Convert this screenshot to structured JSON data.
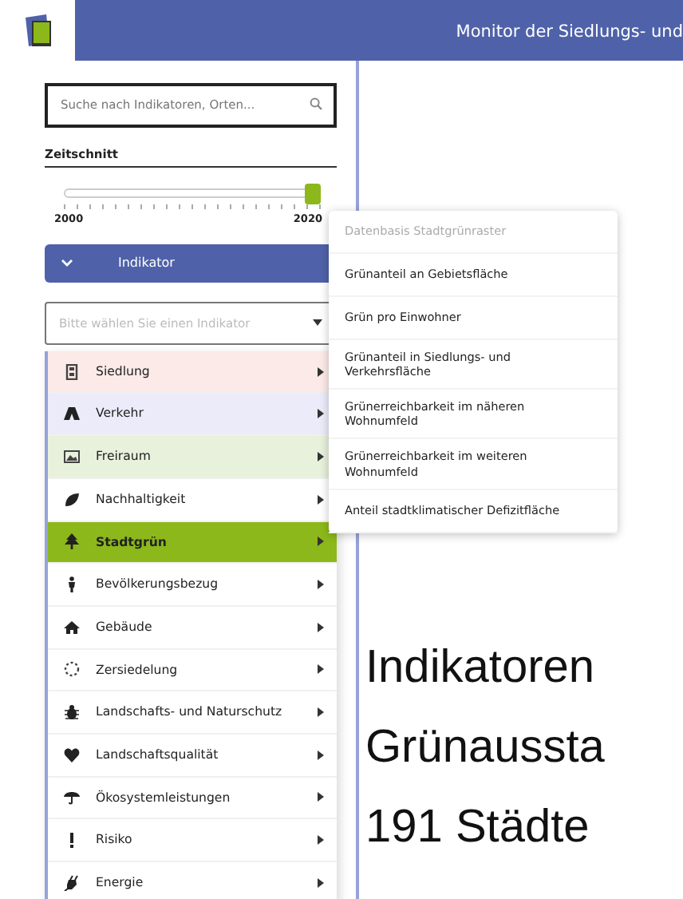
{
  "header": {
    "title": "Monitor der Siedlungs- und"
  },
  "search": {
    "placeholder": "Suche nach Indikatoren, Orten..."
  },
  "timeline": {
    "label": "Zeitschnitt",
    "level": 1.0,
    "start": "2000",
    "end": "2020"
  },
  "indicator_panel": {
    "title": "Indikator",
    "expanded": true
  },
  "indicator_select": {
    "placeholder": "Bitte wählen Sie einen Indikator"
  },
  "categories": [
    {
      "label": "Siedlung",
      "color": "#fbeae8",
      "selected": false
    },
    {
      "label": "Verkehr",
      "color": "#ebebfa",
      "selected": false
    },
    {
      "label": "Freiraum",
      "color": "#e8f1dc",
      "selected": false
    },
    {
      "label": "Nachhaltigkeit",
      "color": "#ffffff",
      "selected": false
    },
    {
      "label": "Stadtgrün",
      "color": "#8cb81b",
      "selected": true
    },
    {
      "label": "Bevölkerungsbezug",
      "color": "#ffffff",
      "selected": false
    },
    {
      "label": "Gebäude",
      "color": "#ffffff",
      "selected": false
    },
    {
      "label": "Zersiedelung",
      "color": "#ffffff",
      "selected": false
    },
    {
      "label": "Landschafts- und Naturschutz",
      "color": "#ffffff",
      "selected": false
    },
    {
      "label": "Landschaftsqualität",
      "color": "#ffffff",
      "selected": false
    },
    {
      "label": "Ökosystemleistungen",
      "color": "#ffffff",
      "selected": false
    },
    {
      "label": "Risiko",
      "color": "#ffffff",
      "selected": false
    },
    {
      "label": "Energie",
      "color": "#ffffff",
      "selected": false
    }
  ],
  "submenu": [
    {
      "label": "Datenbasis Stadtgrünraster",
      "kind": "header"
    },
    {
      "label": "Grünanteil an Gebietsfläche",
      "kind": "item"
    },
    {
      "label": "Grün pro Einwohner",
      "kind": "item"
    },
    {
      "label": "Grünanteil in Siedlungs- und Verkehrsfläche",
      "kind": "item"
    },
    {
      "label": "Grünerreichbarkeit im näheren Wohnumfeld",
      "kind": "item"
    },
    {
      "label": "Grünerreichbarkeit im weiteren Wohnumfeld",
      "kind": "item"
    },
    {
      "label": "Anteil stadtklimatischer Defizitfläche",
      "kind": "item"
    }
  ],
  "main_text": [
    "Indikatoren",
    "Grünaussta",
    "191 Städte"
  ]
}
